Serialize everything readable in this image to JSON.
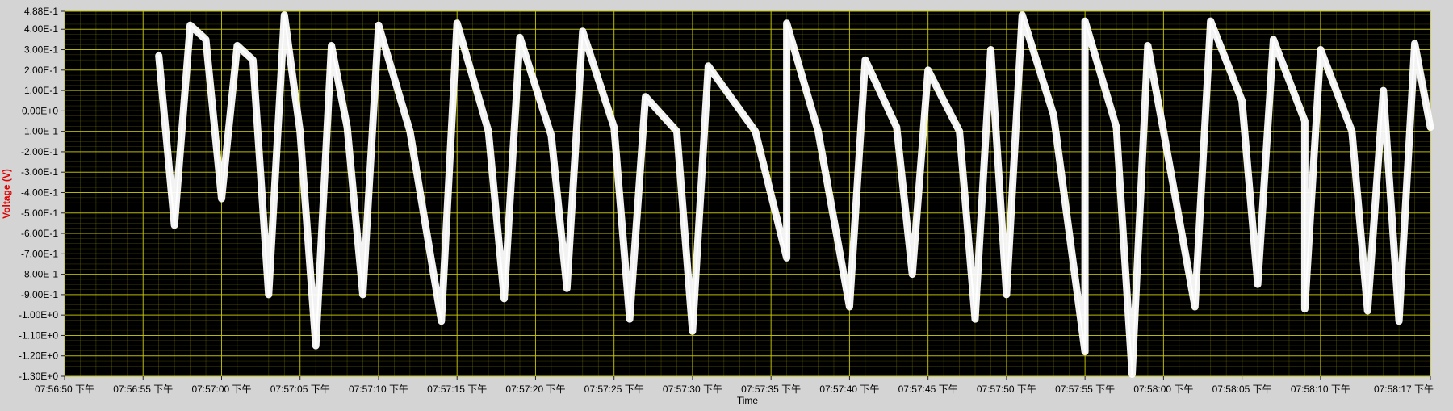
{
  "chart_data": {
    "type": "line",
    "title": "",
    "xlabel": "Time",
    "ylabel": "Voltage (V)",
    "xlim": [
      "07:56:50 下午",
      "07:58:17 下午"
    ],
    "ylim": [
      -1.3,
      0.488
    ],
    "grid": true,
    "y_ticks": [
      {
        "value": 0.488,
        "label": "4.88E-1"
      },
      {
        "value": 0.4,
        "label": "4.00E-1"
      },
      {
        "value": 0.3,
        "label": "3.00E-1"
      },
      {
        "value": 0.2,
        "label": "2.00E-1"
      },
      {
        "value": 0.1,
        "label": "1.00E-1"
      },
      {
        "value": 0.0,
        "label": "0.00E+0"
      },
      {
        "value": -0.1,
        "label": "-1.00E-1"
      },
      {
        "value": -0.2,
        "label": "-2.00E-1"
      },
      {
        "value": -0.3,
        "label": "-3.00E-1"
      },
      {
        "value": -0.4,
        "label": "-4.00E-1"
      },
      {
        "value": -0.5,
        "label": "-5.00E-1"
      },
      {
        "value": -0.6,
        "label": "-6.00E-1"
      },
      {
        "value": -0.7,
        "label": "-7.00E-1"
      },
      {
        "value": -0.8,
        "label": "-8.00E-1"
      },
      {
        "value": -0.9,
        "label": "-9.00E-1"
      },
      {
        "value": -1.0,
        "label": "-1.00E+0"
      },
      {
        "value": -1.1,
        "label": "-1.10E+0"
      },
      {
        "value": -1.2,
        "label": "-1.20E+0"
      },
      {
        "value": -1.3,
        "label": "-1.30E+0"
      }
    ],
    "x_ticks": [
      {
        "value": "07:56:50 下午",
        "label": "07:56:50 下午"
      },
      {
        "value": "07:56:55 下午",
        "label": "07:56:55 下午"
      },
      {
        "value": "07:57:00 下午",
        "label": "07:57:00 下午"
      },
      {
        "value": "07:57:05 下午",
        "label": "07:57:05 下午"
      },
      {
        "value": "07:57:10 下午",
        "label": "07:57:10 下午"
      },
      {
        "value": "07:57:15 下午",
        "label": "07:57:15 下午"
      },
      {
        "value": "07:57:20 下午",
        "label": "07:57:20 下午"
      },
      {
        "value": "07:57:25 下午",
        "label": "07:57:25 下午"
      },
      {
        "value": "07:57:30 下午",
        "label": "07:57:30 下午"
      },
      {
        "value": "07:57:35 下午",
        "label": "07:57:35 下午"
      },
      {
        "value": "07:57:40 下午",
        "label": "07:57:40 下午"
      },
      {
        "value": "07:57:45 下午",
        "label": "07:57:45 下午"
      },
      {
        "value": "07:57:50 下午",
        "label": "07:57:50 下午"
      },
      {
        "value": "07:57:55 下午",
        "label": "07:57:55 下午"
      },
      {
        "value": "07:58:00 下午",
        "label": "07:58:00 下午"
      },
      {
        "value": "07:58:05 下午",
        "label": "07:58:05 下午"
      },
      {
        "value": "07:58:10 下午",
        "label": "07:58:10 下午"
      },
      {
        "value": "07:58:17 下午",
        "label": "07:58:17 下午"
      }
    ],
    "series": [
      {
        "color": "#ffffff",
        "points": [
          {
            "x": "07:56:56 下午",
            "y": 0.27
          },
          {
            "x": "07:56:57 下午",
            "y": -0.56
          },
          {
            "x": "07:56:58 下午",
            "y": 0.42
          },
          {
            "x": "07:56:59 下午",
            "y": 0.35
          },
          {
            "x": "07:57:00 下午",
            "y": -0.43
          },
          {
            "x": "07:57:01 下午",
            "y": 0.32
          },
          {
            "x": "07:57:02 下午",
            "y": 0.25
          },
          {
            "x": "07:57:03 下午",
            "y": -0.9
          },
          {
            "x": "07:57:04 下午",
            "y": 0.47
          },
          {
            "x": "07:57:05 下午",
            "y": -0.1
          },
          {
            "x": "07:57:06 下午",
            "y": -1.15
          },
          {
            "x": "07:57:07 下午",
            "y": 0.32
          },
          {
            "x": "07:57:08 下午",
            "y": -0.08
          },
          {
            "x": "07:57:09 下午",
            "y": -0.9
          },
          {
            "x": "07:57:10 下午",
            "y": 0.42
          },
          {
            "x": "07:57:12 下午",
            "y": -0.1
          },
          {
            "x": "07:57:14 下午",
            "y": -1.03
          },
          {
            "x": "07:57:15 下午",
            "y": 0.43
          },
          {
            "x": "07:57:17 下午",
            "y": -0.1
          },
          {
            "x": "07:57:18 下午",
            "y": -0.92
          },
          {
            "x": "07:57:19 下午",
            "y": 0.36
          },
          {
            "x": "07:57:21 下午",
            "y": -0.12
          },
          {
            "x": "07:57:22 下午",
            "y": -0.87
          },
          {
            "x": "07:57:23 下午",
            "y": 0.39
          },
          {
            "x": "07:57:25 下午",
            "y": -0.08
          },
          {
            "x": "07:57:26 下午",
            "y": -1.02
          },
          {
            "x": "07:57:27 下午",
            "y": 0.07
          },
          {
            "x": "07:57:29 下午",
            "y": -0.1
          },
          {
            "x": "07:57:30 下午",
            "y": -1.08
          },
          {
            "x": "07:57:31 下午",
            "y": 0.22
          },
          {
            "x": "07:57:34 下午",
            "y": -0.1
          },
          {
            "x": "07:57:36 下午",
            "y": -0.72
          },
          {
            "x": "07:57:36 下午",
            "y": 0.43
          },
          {
            "x": "07:57:38 下午",
            "y": -0.1
          },
          {
            "x": "07:57:40 下午",
            "y": -0.96
          },
          {
            "x": "07:57:41 下午",
            "y": 0.25
          },
          {
            "x": "07:57:43 下午",
            "y": -0.08
          },
          {
            "x": "07:57:44 下午",
            "y": -0.8
          },
          {
            "x": "07:57:45 下午",
            "y": 0.2
          },
          {
            "x": "07:57:47 下午",
            "y": -0.1
          },
          {
            "x": "07:57:48 下午",
            "y": -1.02
          },
          {
            "x": "07:57:49 下午",
            "y": 0.3
          },
          {
            "x": "07:57:50 下午",
            "y": -0.9
          },
          {
            "x": "07:57:51 下午",
            "y": 0.47
          },
          {
            "x": "07:57:53 下午",
            "y": -0.02
          },
          {
            "x": "07:57:55 下午",
            "y": -1.18
          },
          {
            "x": "07:57:55 下午",
            "y": 0.44
          },
          {
            "x": "07:57:57 下午",
            "y": -0.08
          },
          {
            "x": "07:57:58 下午",
            "y": -1.29
          },
          {
            "x": "07:57:59 下午",
            "y": 0.32
          },
          {
            "x": "07:58:00 下午",
            "y": -0.1
          },
          {
            "x": "07:58:02 下午",
            "y": -0.96
          },
          {
            "x": "07:58:03 下午",
            "y": 0.44
          },
          {
            "x": "07:58:05 下午",
            "y": 0.05
          },
          {
            "x": "07:58:06 下午",
            "y": -0.85
          },
          {
            "x": "07:58:07 下午",
            "y": 0.35
          },
          {
            "x": "07:58:09 下午",
            "y": -0.05
          },
          {
            "x": "07:58:09 下午",
            "y": -0.97
          },
          {
            "x": "07:58:10 下午",
            "y": 0.3
          },
          {
            "x": "07:58:12 下午",
            "y": -0.1
          },
          {
            "x": "07:58:13 下午",
            "y": -0.98
          },
          {
            "x": "07:58:14 下午",
            "y": 0.1
          },
          {
            "x": "07:58:15 下午",
            "y": -1.03
          },
          {
            "x": "07:58:16 下午",
            "y": 0.33
          },
          {
            "x": "07:58:17 下午",
            "y": -0.08
          }
        ]
      }
    ]
  },
  "colors": {
    "plot_background": "#000000",
    "grid": "#7a7a00",
    "trace": "#ffffff",
    "ylabel": "#e00000",
    "frame": "#d4d4d4"
  }
}
